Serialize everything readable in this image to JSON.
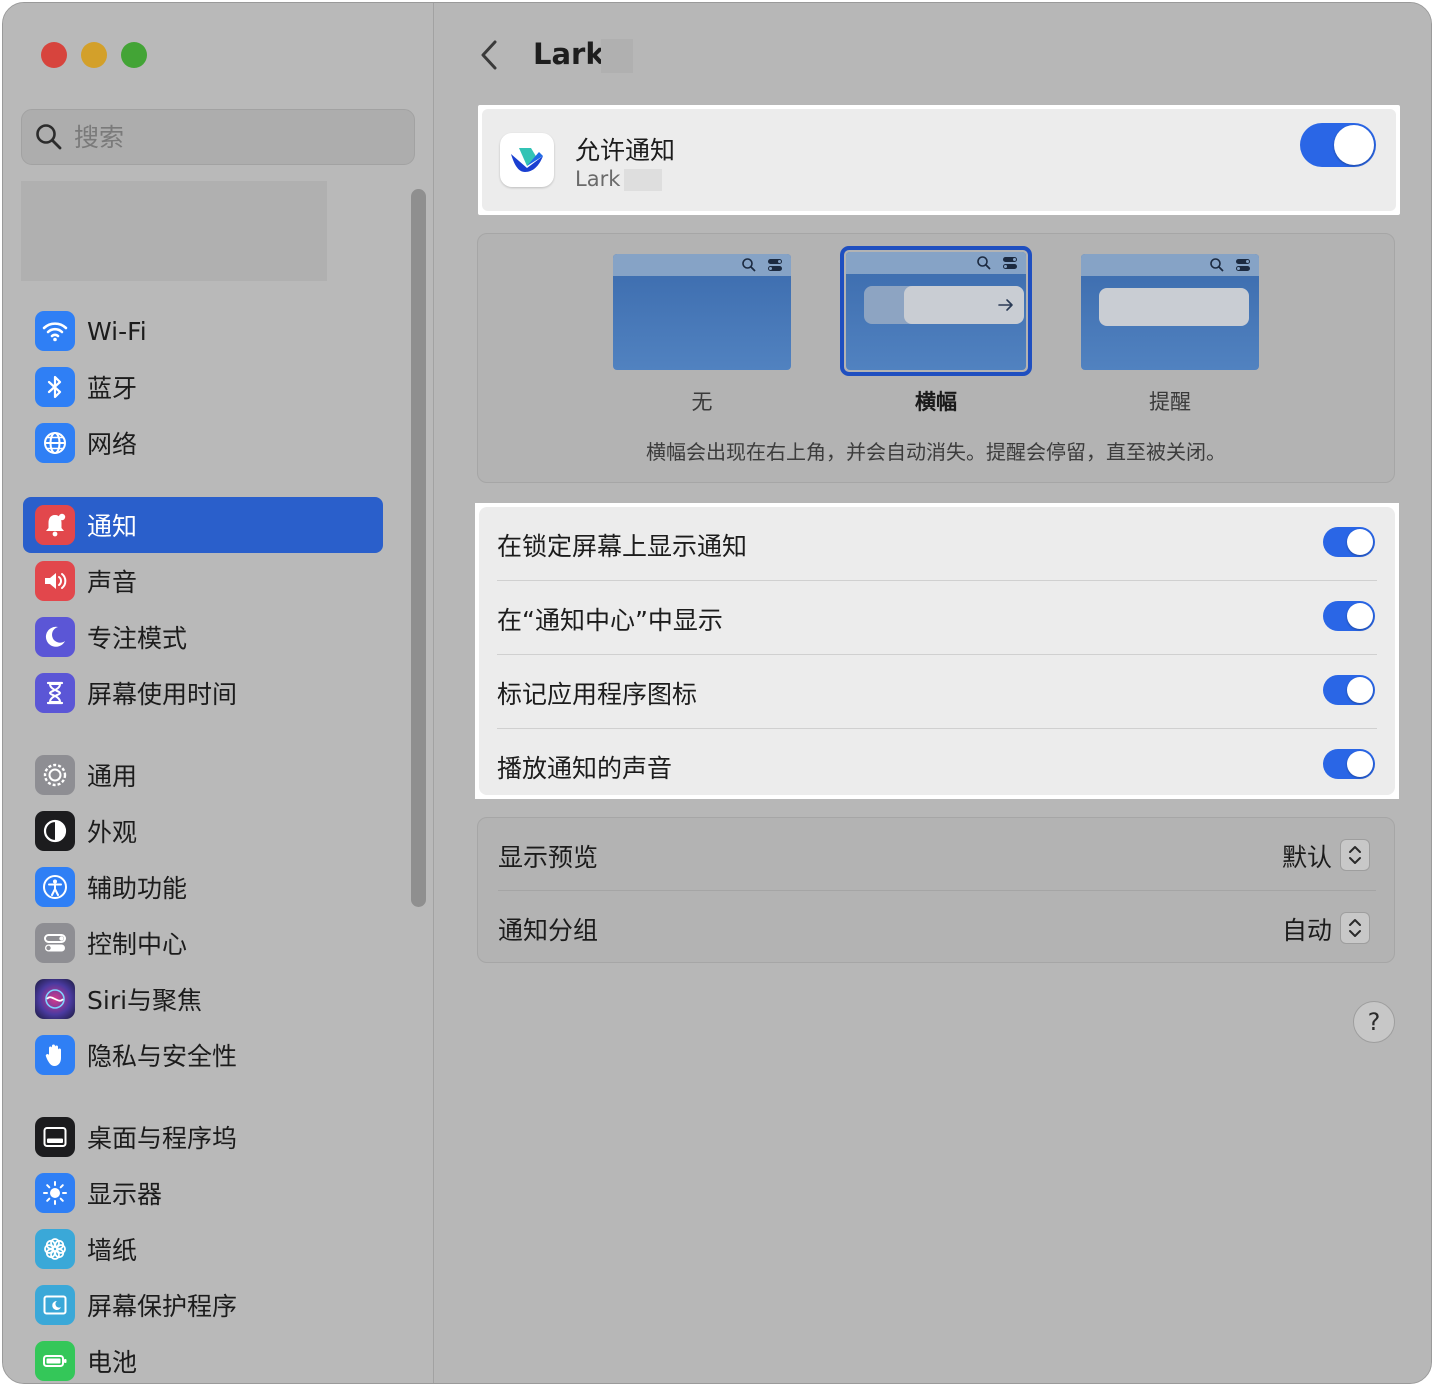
{
  "window": {
    "traffic_lights": [
      "close",
      "minimize",
      "zoom"
    ]
  },
  "sidebar": {
    "search_placeholder": "搜索",
    "items": [
      {
        "label": "Wi-Fi",
        "icon": "wifi-icon",
        "color": "#2f7ff5"
      },
      {
        "label": "蓝牙",
        "icon": "bluetooth-icon",
        "color": "#2f7ff5"
      },
      {
        "label": "网络",
        "icon": "globe-icon",
        "color": "#2f7ff5"
      },
      {
        "label": "通知",
        "icon": "bell-icon",
        "color": "#e2474c",
        "selected": true
      },
      {
        "label": "声音",
        "icon": "speaker-icon",
        "color": "#e2474c"
      },
      {
        "label": "专注模式",
        "icon": "moon-icon",
        "color": "#5b56d6"
      },
      {
        "label": "屏幕使用时间",
        "icon": "hourglass-icon",
        "color": "#5b56d6"
      },
      {
        "label": "通用",
        "icon": "gear-icon",
        "color": "#8e8e93"
      },
      {
        "label": "外观",
        "icon": "appearance-icon",
        "color": "#1c1c1e"
      },
      {
        "label": "辅助功能",
        "icon": "accessibility-icon",
        "color": "#2f7ff5"
      },
      {
        "label": "控制中心",
        "icon": "control-center-icon",
        "color": "#8e8e93"
      },
      {
        "label": "Siri与聚焦",
        "icon": "siri-icon",
        "color": "#3a2a6a"
      },
      {
        "label": "隐私与安全性",
        "icon": "hand-icon",
        "color": "#2f7ff5"
      },
      {
        "label": "桌面与程序坞",
        "icon": "dock-icon",
        "color": "#1c1c1e"
      },
      {
        "label": "显示器",
        "icon": "sun-icon",
        "color": "#2f7ff5"
      },
      {
        "label": "墙纸",
        "icon": "flower-icon",
        "color": "#3aa8d8"
      },
      {
        "label": "屏幕保护程序",
        "icon": "screensaver-icon",
        "color": "#3aa8d8"
      },
      {
        "label": "电池",
        "icon": "battery-icon",
        "color": "#34c759"
      }
    ]
  },
  "header": {
    "title": "Lark"
  },
  "allow": {
    "title": "允许通知",
    "subtitle": "Lark",
    "enabled": true
  },
  "alert_style": {
    "options": [
      "无",
      "横幅",
      "提醒"
    ],
    "selected": "横幅",
    "description": "横幅会出现在右上角，并会自动消失。提醒会停留，直至被关闭。"
  },
  "options": [
    {
      "label": "在锁定屏幕上显示通知",
      "enabled": true
    },
    {
      "label": "在“通知中心”中显示",
      "enabled": true
    },
    {
      "label": "标记应用程序图标",
      "enabled": true
    },
    {
      "label": "播放通知的声音",
      "enabled": true
    }
  ],
  "selects": [
    {
      "label": "显示预览",
      "value": "默认"
    },
    {
      "label": "通知分组",
      "value": "自动"
    }
  ],
  "help": "?",
  "colors": {
    "accent": "#2a66e6",
    "selected_sidebar": "#2a5fcb"
  }
}
